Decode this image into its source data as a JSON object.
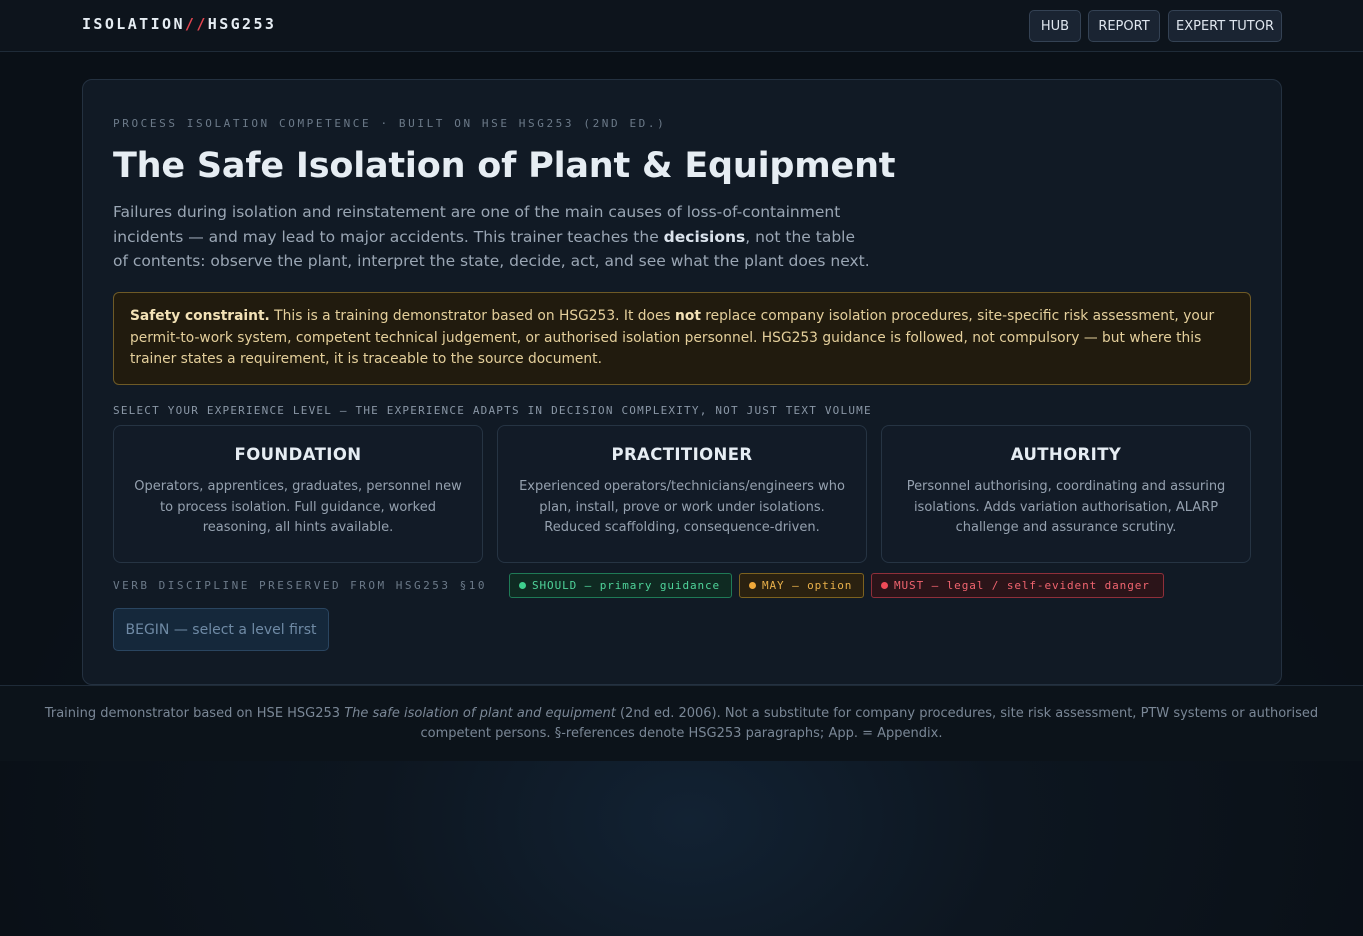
{
  "header": {
    "brand_left": "ISOLATION",
    "brand_sep": "//",
    "brand_right": "HSG253",
    "nav": [
      "HUB",
      "REPORT",
      "EXPERT TUTOR"
    ]
  },
  "hero": {
    "eyebrow": "PROCESS ISOLATION COMPETENCE · BUILT ON HSE HSG253 (2ND ED.)",
    "title": "The Safe Isolation of Plant & Equipment",
    "intro_pre": "Failures during isolation and reinstatement are one of the main causes of loss-of-containment incidents — and may lead to major accidents. This trainer teaches the ",
    "intro_bold": "decisions",
    "intro_post": ", not the table of contents: observe the plant, interpret the state, decide, act, and see what the plant does next."
  },
  "safety": {
    "label": "Safety constraint.",
    "text_a": " This is a training demonstrator based on HSG253. It does ",
    "text_bold": "not",
    "text_b": " replace company isolation procedures, site-specific risk assessment, your permit-to-work system, competent technical judgement, or authorised isolation personnel. HSG253 guidance is followed, not compulsory — but where this trainer states a requirement, it is traceable to the source document."
  },
  "levels": {
    "label": "SELECT YOUR EXPERIENCE LEVEL — THE EXPERIENCE ADAPTS IN DECISION COMPLEXITY, NOT JUST TEXT VOLUME",
    "items": [
      {
        "name": "FOUNDATION",
        "desc": "Operators, apprentices, graduates, personnel new to process isolation. Full guidance, worked reasoning, all hints available."
      },
      {
        "name": "PRACTITIONER",
        "desc": "Experienced operators/technicians/engineers who plan, install, prove or work under isolations. Reduced scaffolding, consequence-driven."
      },
      {
        "name": "AUTHORITY",
        "desc": "Personnel authorising, coordinating and assuring isolations. Adds variation authorisation, ALARP challenge and assurance scrutiny."
      }
    ]
  },
  "verbs": {
    "label": "VERB DISCIPLINE PRESERVED FROM HSG253 §10",
    "should": "SHOULD — primary guidance",
    "may": "MAY — option",
    "must": "MUST — legal / self-evident danger"
  },
  "begin_label": "BEGIN — select a level first",
  "footer": {
    "pre": "Training demonstrator based on HSE HSG253 ",
    "italic": "The safe isolation of plant and equipment",
    "post": " (2nd ed. 2006). Not a substitute for company procedures, site risk assessment, PTW systems or authorised competent persons. §-references denote HSG253 paragraphs; App. = Appendix."
  },
  "colors": {
    "should": "#3ecf8e",
    "may": "#f0a93a",
    "must": "#ef4b58",
    "brand_accent": "#e0454f"
  }
}
